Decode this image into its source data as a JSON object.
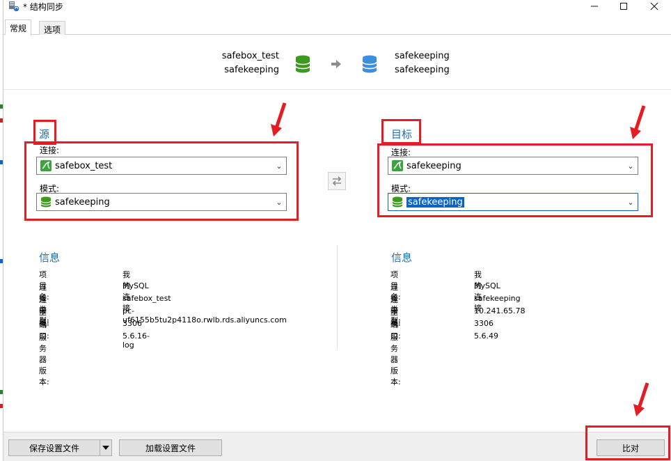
{
  "window": {
    "title": "* 结构同步",
    "minimize_icon": "minimize-icon",
    "maximize_icon": "maximize-icon",
    "close_icon": "close-icon"
  },
  "tabs": [
    {
      "label": "常规",
      "active": true
    },
    {
      "label": "选项",
      "active": false
    }
  ],
  "summary": {
    "source_connection": "safebox_test",
    "source_schema": "safekeeping",
    "target_connection": "safekeeping",
    "target_schema": "safekeeping",
    "source_icon": "database-green-icon",
    "target_icon": "database-blue-icon",
    "arrow_icon": "arrow-right-icon"
  },
  "source": {
    "title": "源",
    "connection_label": "连接:",
    "connection_value": "safebox_test",
    "schema_label": "模式:",
    "schema_value": "safekeeping"
  },
  "target": {
    "title": "目标",
    "connection_label": "连接:",
    "connection_value": "safekeeping",
    "schema_label": "模式:",
    "schema_value": "safekeeping"
  },
  "source_info": {
    "title": "信息",
    "rows": [
      {
        "key": "项目名:",
        "value": "我的连接"
      },
      {
        "key": "连接类型:",
        "value": "MySQL"
      },
      {
        "key": "连接名:",
        "value": "safebox_test"
      },
      {
        "key": "主机:",
        "value": "pc-uf6155b5tu2p4118o.rwlb.rds.aliyuncs.com"
      },
      {
        "key": "端口:",
        "value": "3306"
      },
      {
        "key": "服务器版本:",
        "value": "5.6.16-log"
      }
    ]
  },
  "target_info": {
    "title": "信息",
    "rows": [
      {
        "key": "项目名:",
        "value": "我的连接"
      },
      {
        "key": "连接类型:",
        "value": "MySQL"
      },
      {
        "key": "连接名:",
        "value": "safekeeping"
      },
      {
        "key": "主机:",
        "value": "10.241.65.78"
      },
      {
        "key": "端口:",
        "value": "3306"
      },
      {
        "key": "服务器版本:",
        "value": "5.6.49"
      }
    ]
  },
  "footer": {
    "save_label": "保存设置文件",
    "load_label": "加载设置文件",
    "compare_label": "比对"
  },
  "colors": {
    "accent": "#1c6fb5",
    "highlight_red": "#e51c23",
    "selection": "#0a64c8",
    "db_green": "#3c9a1e",
    "db_blue": "#3d8ee0"
  }
}
